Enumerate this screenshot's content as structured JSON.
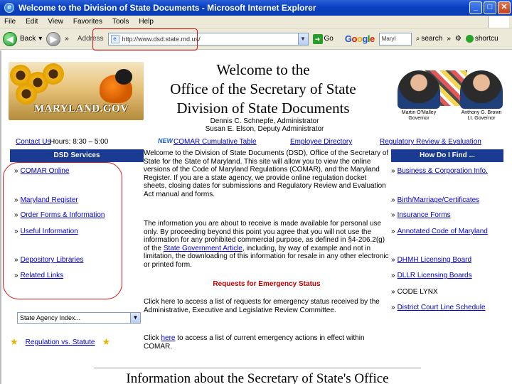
{
  "window": {
    "title": "Welcome to the Division of State Documents - Microsoft Internet Explorer",
    "min": "_",
    "max": "□",
    "close": "✕"
  },
  "menu": [
    "File",
    "Edit",
    "View",
    "Favorites",
    "Tools",
    "Help"
  ],
  "toolbar": {
    "back_label": "Back",
    "address_label": "Address",
    "address_value": "http://www.dsd.state.md.us/",
    "go_label": "Go",
    "google_search_value": "Maryl",
    "search_label": "search",
    "more_label": "»",
    "shortcut_label": "shortcu"
  },
  "header": {
    "logo_text": "MARYLAND.GOV",
    "title_lines": [
      "Welcome to the",
      "Office of the Secretary of State",
      "Division of State Documents"
    ],
    "admins": [
      "Dennis C. Schnepfe, Administrator",
      "Susan E. Elson, Deputy Administrator"
    ],
    "photo_captions": [
      {
        "name": "Martin O'Malley",
        "role": "Governor"
      },
      {
        "name": "Anthony G. Brown",
        "role": "Lt. Governor"
      }
    ]
  },
  "nav": {
    "contact": "Contact Us",
    "hours": "Hours: 8:30 – 5:00",
    "new_badge": "NEW",
    "comar_table": "COMAR Cumulative Table",
    "employee_dir": "Employee Directory",
    "reg_review": "Regulatory Review & Evaluation"
  },
  "sidebar": {
    "heading": "DSD Services",
    "items": [
      {
        "label": "COMAR Online"
      },
      {
        "label": "Maryland Register"
      },
      {
        "label": "Order Forms & Information"
      },
      {
        "label": "Useful Information"
      },
      {
        "label": "Depository Libraries"
      },
      {
        "label": "Related Links"
      }
    ],
    "agency_select": "State Agency Index...",
    "reg_statute": "Regulation vs. Statute"
  },
  "main": {
    "intro_a": "Welcome to the Division of State Documents (DSD), Office of the Secretary of State for the State of Maryland. This site will allow you to view the online versions of the Code of Maryland Regulations (COMAR), and the Maryland Register. If you are a state agency, we provide online regulation docket sheets, closing dates for submissions and Regulatory Review and Evaluation Act manual and forms.",
    "disclaimer_a": "The information you are about to receive is made available for personal use only. By proceeding beyond this point you agree that you will not use the information for any prohibited commercial purpose, as defined in §4-206.2(g) of the",
    "disclaimer_link": "State Government Article",
    "disclaimer_b": ", including, by way of example and not in limitation, the downloading of this information for resale in any other electronic or printed form.",
    "emergency_heading": "Requests for Emergency Status",
    "emergency_1": "Click here to access a list of requests for emergency status received by the Administrative, Executive and Legislative Review Committee.",
    "emergency_2a": "Click",
    "emergency_2_link": "here",
    "emergency_2b": "to access a list of current emergency actions in effect within COMAR."
  },
  "right": {
    "heading": "How Do I Find ...",
    "items": [
      {
        "label": "Business & Corporation Info.",
        "link": true
      },
      {
        "label": "Birth/Marriage/Certificates",
        "link": true
      },
      {
        "label": "Insurance Forms",
        "link": true
      },
      {
        "label": "Annotated Code of Maryland",
        "link": true
      },
      {
        "label": "DHMH Licensing Board",
        "link": true
      },
      {
        "label": "DLLR Licensing Boards",
        "link": true
      },
      {
        "label": "CODE LYNX",
        "link": false
      },
      {
        "label": "District Court Line Schedule",
        "link": true
      }
    ]
  },
  "footer": {
    "title": "Information about the Secretary of State's Office"
  }
}
